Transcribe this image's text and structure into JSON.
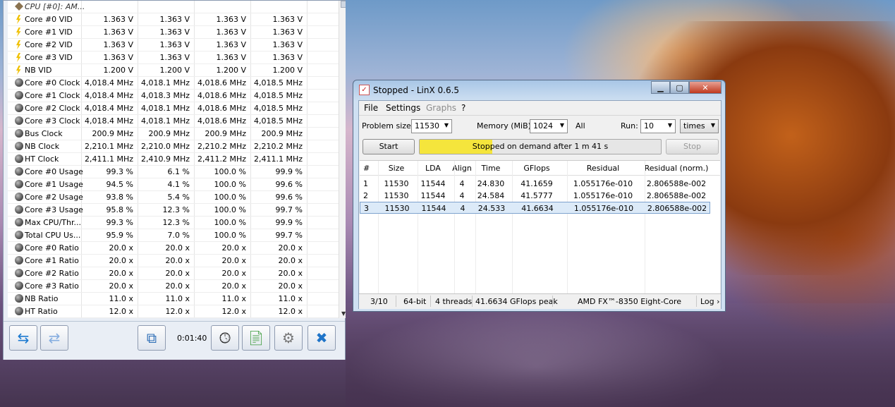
{
  "hwinfo": {
    "group_label": "CPU [#0]: AM...",
    "rows": [
      {
        "icon": "bolt-icon",
        "label": "Core #0 VID",
        "values": [
          "1.363 V",
          "1.363 V",
          "1.363 V",
          "1.363 V"
        ]
      },
      {
        "icon": "bolt-icon",
        "label": "Core #1 VID",
        "values": [
          "1.363 V",
          "1.363 V",
          "1.363 V",
          "1.363 V"
        ]
      },
      {
        "icon": "bolt-icon",
        "label": "Core #2 VID",
        "values": [
          "1.363 V",
          "1.363 V",
          "1.363 V",
          "1.363 V"
        ]
      },
      {
        "icon": "bolt-icon",
        "label": "Core #3 VID",
        "values": [
          "1.363 V",
          "1.363 V",
          "1.363 V",
          "1.363 V"
        ]
      },
      {
        "icon": "bolt-icon",
        "label": "NB VID",
        "values": [
          "1.200 V",
          "1.200 V",
          "1.200 V",
          "1.200 V"
        ]
      },
      {
        "icon": "gauge-icon",
        "label": "Core #0 Clock",
        "values": [
          "4,018.4 MHz",
          "4,018.1 MHz",
          "4,018.6 MHz",
          "4,018.5 MHz"
        ]
      },
      {
        "icon": "gauge-icon",
        "label": "Core #1 Clock",
        "values": [
          "4,018.4 MHz",
          "4,018.3 MHz",
          "4,018.6 MHz",
          "4,018.5 MHz"
        ]
      },
      {
        "icon": "gauge-icon",
        "label": "Core #2 Clock",
        "values": [
          "4,018.4 MHz",
          "4,018.1 MHz",
          "4,018.6 MHz",
          "4,018.5 MHz"
        ]
      },
      {
        "icon": "gauge-icon",
        "label": "Core #3 Clock",
        "values": [
          "4,018.4 MHz",
          "4,018.1 MHz",
          "4,018.6 MHz",
          "4,018.5 MHz"
        ]
      },
      {
        "icon": "gauge-icon",
        "label": "Bus Clock",
        "values": [
          "200.9 MHz",
          "200.9 MHz",
          "200.9 MHz",
          "200.9 MHz"
        ]
      },
      {
        "icon": "gauge-icon",
        "label": "NB Clock",
        "values": [
          "2,210.1 MHz",
          "2,210.0 MHz",
          "2,210.2 MHz",
          "2,210.2 MHz"
        ]
      },
      {
        "icon": "gauge-icon",
        "label": "HT Clock",
        "values": [
          "2,411.1 MHz",
          "2,410.9 MHz",
          "2,411.2 MHz",
          "2,411.1 MHz"
        ]
      },
      {
        "icon": "gauge-icon",
        "label": "Core #0 Usage",
        "values": [
          "99.3 %",
          "6.1 %",
          "100.0 %",
          "99.9 %"
        ]
      },
      {
        "icon": "gauge-icon",
        "label": "Core #1 Usage",
        "values": [
          "94.5 %",
          "4.1 %",
          "100.0 %",
          "99.6 %"
        ]
      },
      {
        "icon": "gauge-icon",
        "label": "Core #2 Usage",
        "values": [
          "93.8 %",
          "5.4 %",
          "100.0 %",
          "99.6 %"
        ]
      },
      {
        "icon": "gauge-icon",
        "label": "Core #3 Usage",
        "values": [
          "95.8 %",
          "12.3 %",
          "100.0 %",
          "99.7 %"
        ]
      },
      {
        "icon": "gauge-icon",
        "label": "Max CPU/Thr...",
        "values": [
          "99.3 %",
          "12.3 %",
          "100.0 %",
          "99.9 %"
        ]
      },
      {
        "icon": "gauge-icon",
        "label": "Total CPU Us...",
        "values": [
          "95.9 %",
          "7.0 %",
          "100.0 %",
          "99.7 %"
        ]
      },
      {
        "icon": "gauge-icon",
        "label": "Core #0 Ratio",
        "values": [
          "20.0 x",
          "20.0 x",
          "20.0 x",
          "20.0 x"
        ]
      },
      {
        "icon": "gauge-icon",
        "label": "Core #1 Ratio",
        "values": [
          "20.0 x",
          "20.0 x",
          "20.0 x",
          "20.0 x"
        ]
      },
      {
        "icon": "gauge-icon",
        "label": "Core #2 Ratio",
        "values": [
          "20.0 x",
          "20.0 x",
          "20.0 x",
          "20.0 x"
        ]
      },
      {
        "icon": "gauge-icon",
        "label": "Core #3 Ratio",
        "values": [
          "20.0 x",
          "20.0 x",
          "20.0 x",
          "20.0 x"
        ]
      },
      {
        "icon": "gauge-icon",
        "label": "NB Ratio",
        "values": [
          "11.0 x",
          "11.0 x",
          "11.0 x",
          "11.0 x"
        ]
      },
      {
        "icon": "gauge-icon",
        "label": "HT Ratio",
        "values": [
          "12.0 x",
          "12.0 x",
          "12.0 x",
          "12.0 x"
        ]
      }
    ],
    "toolbar": {
      "elapsed": "0:01:40"
    }
  },
  "linx": {
    "title": "Stopped - LinX 0.6.5",
    "menu": {
      "file": "File",
      "settings": "Settings",
      "graphs": "Graphs",
      "help": "?"
    },
    "problem_size_label": "Problem size:",
    "problem_size_value": "11530",
    "memory_label": "Memory (MiB):",
    "memory_value": "1024",
    "all_label": "All",
    "run_label": "Run:",
    "run_value": "10",
    "run_unit": "times",
    "start_label": "Start",
    "stop_label": "Stop",
    "progress_fraction": 0.3,
    "progress_text": "Stopped on demand after 1 m 41 s",
    "columns": [
      "#",
      "Size",
      "LDA",
      "Align",
      "Time",
      "GFlops",
      "Residual",
      "Residual (norm.)"
    ],
    "rows": [
      [
        "1",
        "11530",
        "11544",
        "4",
        "24.830",
        "41.1659",
        "1.055176e-010",
        "2.806588e-002"
      ],
      [
        "2",
        "11530",
        "11544",
        "4",
        "24.584",
        "41.5777",
        "1.055176e-010",
        "2.806588e-002"
      ],
      [
        "3",
        "11530",
        "11544",
        "4",
        "24.533",
        "41.6634",
        "1.055176e-010",
        "2.806588e-002"
      ]
    ],
    "status": {
      "progress": "3/10",
      "bits": "64-bit",
      "threads": "4 threads",
      "peak": "41.6634 GFlops peak",
      "cpu": "AMD FX™-8350 Eight-Core",
      "log": "Log ›"
    }
  }
}
